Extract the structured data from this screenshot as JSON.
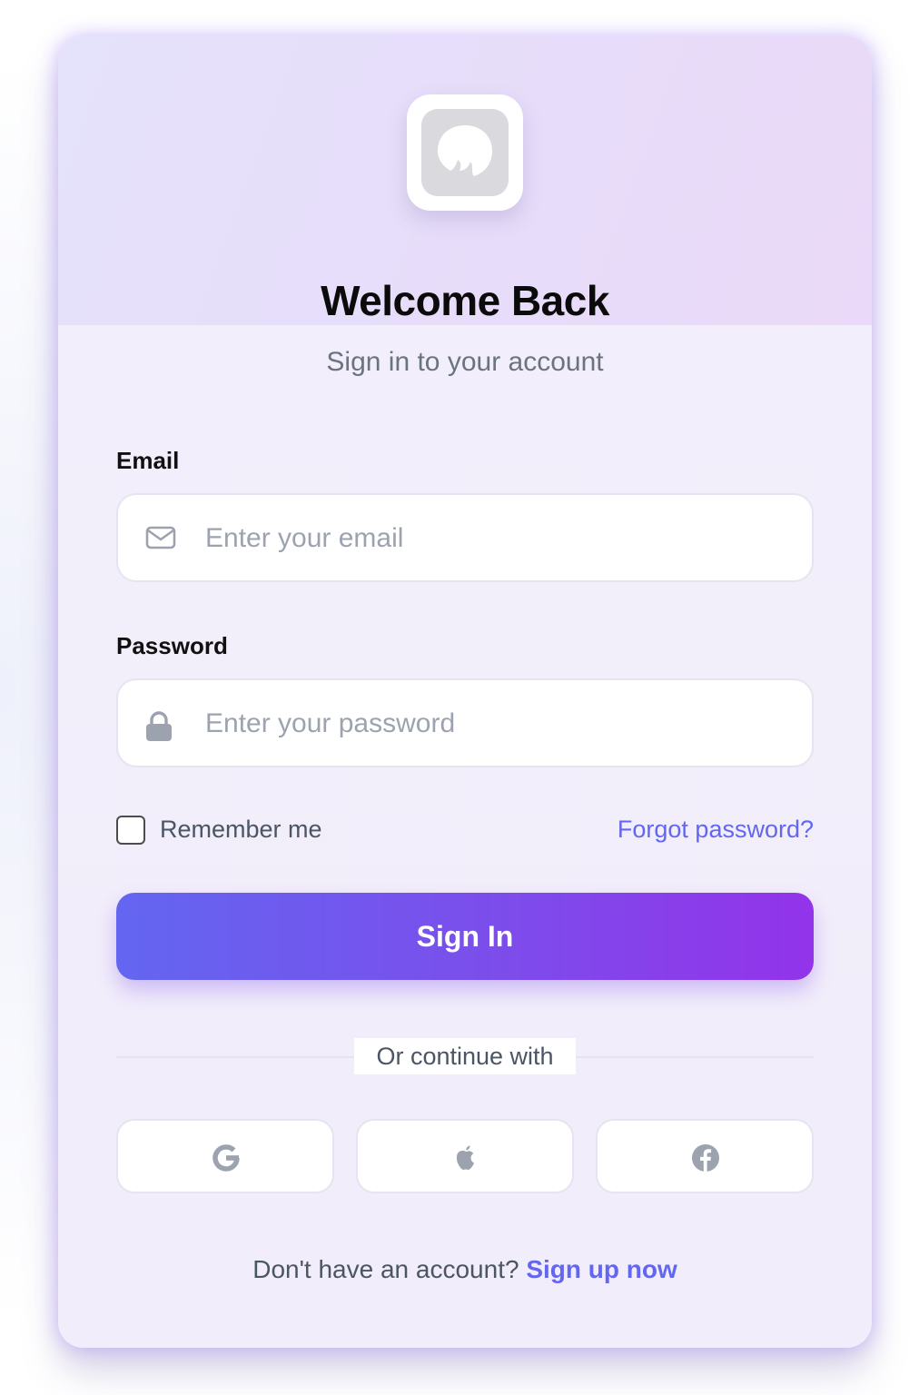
{
  "header": {
    "title": "Welcome Back",
    "subtitle": "Sign in to your account"
  },
  "email": {
    "label": "Email",
    "placeholder": "Enter your email",
    "value": ""
  },
  "password": {
    "label": "Password",
    "placeholder": "Enter your password",
    "value": ""
  },
  "remember": {
    "label": "Remember me",
    "checked": false
  },
  "forgot_label": "Forgot password?",
  "signin_label": "Sign In",
  "divider_label": "Or continue with",
  "social": [
    {
      "icon": "google-icon"
    },
    {
      "icon": "apple-icon"
    },
    {
      "icon": "facebook-icon"
    }
  ],
  "signup": {
    "prompt": "Don't have an account?",
    "link": "Sign up now"
  },
  "colors": {
    "accent": "#6366f1",
    "button_gradient_start": "#6366f1",
    "button_gradient_end": "#9333ea",
    "muted_text": "#6b7280",
    "icon_gray": "#9ca3af"
  }
}
